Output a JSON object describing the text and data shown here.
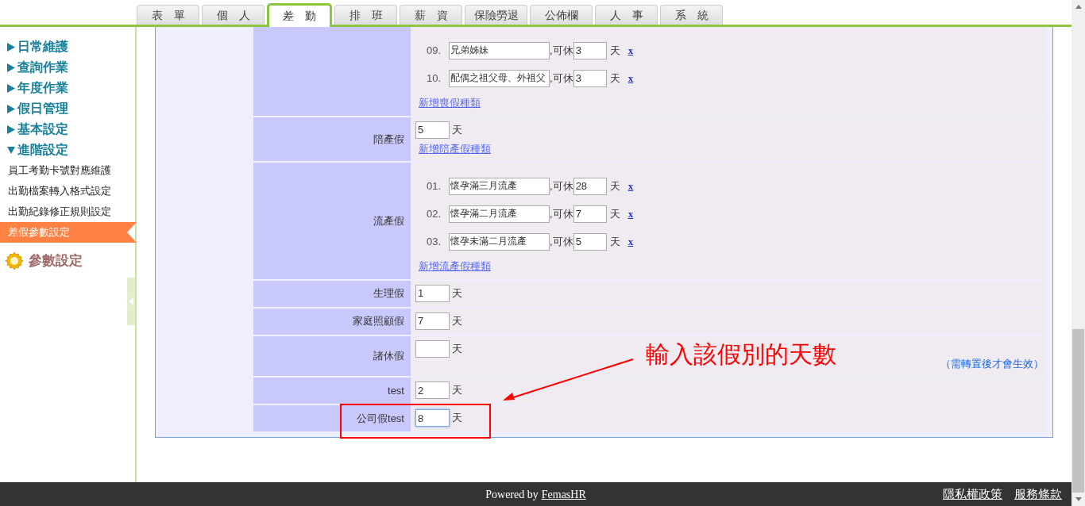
{
  "tabs": [
    {
      "label": "表　單",
      "selected": false
    },
    {
      "label": "個　人",
      "selected": false
    },
    {
      "label": "差　勤",
      "selected": true
    },
    {
      "label": "排　班",
      "selected": false
    },
    {
      "label": "薪　資",
      "selected": false
    },
    {
      "label": "保險勞退",
      "selected": false
    },
    {
      "label": "公佈欄",
      "selected": false
    },
    {
      "label": "人　事",
      "selected": false
    },
    {
      "label": "系　統",
      "selected": false
    }
  ],
  "sidebar": {
    "groups": [
      {
        "label": "日常維護",
        "expanded": false
      },
      {
        "label": "查詢作業",
        "expanded": false
      },
      {
        "label": "年度作業",
        "expanded": false
      },
      {
        "label": "假日管理",
        "expanded": false
      },
      {
        "label": "基本設定",
        "expanded": false
      },
      {
        "label": "進階設定",
        "expanded": true,
        "children": [
          {
            "label": "員工考勤卡號對應維護",
            "selected": false
          },
          {
            "label": "出勤檔案轉入格式設定",
            "selected": false
          },
          {
            "label": "出勤紀錄修正規則設定",
            "selected": false
          },
          {
            "label": "差假參數設定",
            "selected": true
          }
        ]
      }
    ],
    "section_title": "參數設定"
  },
  "leave_rows": [
    {
      "kind": "list",
      "items": [
        {
          "index": "09.",
          "name": "兄弟姊妹",
          "connector": ",可休",
          "days": "3",
          "unit": "天",
          "remove": "x"
        },
        {
          "index": "10.",
          "name": "配偶之祖父母、外祖父",
          "connector": ",可休",
          "days": "3",
          "unit": "天",
          "remove": "x"
        }
      ],
      "add_link": "新增喪假種類"
    },
    {
      "kind": "single",
      "label": "陪產假",
      "days": "5",
      "unit": "天",
      "focused": false,
      "add_link": "新增陪產假種類"
    },
    {
      "kind": "list",
      "label": "流產假",
      "items": [
        {
          "index": "01.",
          "name": "懷孕滿三月流產",
          "connector": ",可休",
          "days": "28",
          "unit": "天",
          "remove": "x"
        },
        {
          "index": "02.",
          "name": "懷孕滿二月流產",
          "connector": ",可休",
          "days": "7",
          "unit": "天",
          "remove": "x"
        },
        {
          "index": "03.",
          "name": "懷孕未滿二月流產",
          "connector": ",可休",
          "days": "5",
          "unit": "天",
          "remove": "x"
        }
      ],
      "add_link": "新增流產假種類"
    },
    {
      "kind": "single",
      "label": "生理假",
      "days": "1",
      "unit": "天",
      "focused": false
    },
    {
      "kind": "single",
      "label": "家庭照顧假",
      "days": "7",
      "unit": "天",
      "focused": false
    },
    {
      "kind": "single",
      "label": "諸休假",
      "days": "",
      "unit": "天",
      "focused": false,
      "note": "（需轉置後才會生效）"
    },
    {
      "kind": "single",
      "label": "test",
      "days": "2",
      "unit": "天",
      "focused": false
    },
    {
      "kind": "single",
      "label": "公司假test",
      "days": "8",
      "unit": "天",
      "focused": true
    }
  ],
  "annotation": "輸入該假別的天數",
  "footer": {
    "prefix": "Powered by",
    "brand": "FemasHR",
    "links": [
      "隱私權政策",
      "服務條款"
    ]
  }
}
